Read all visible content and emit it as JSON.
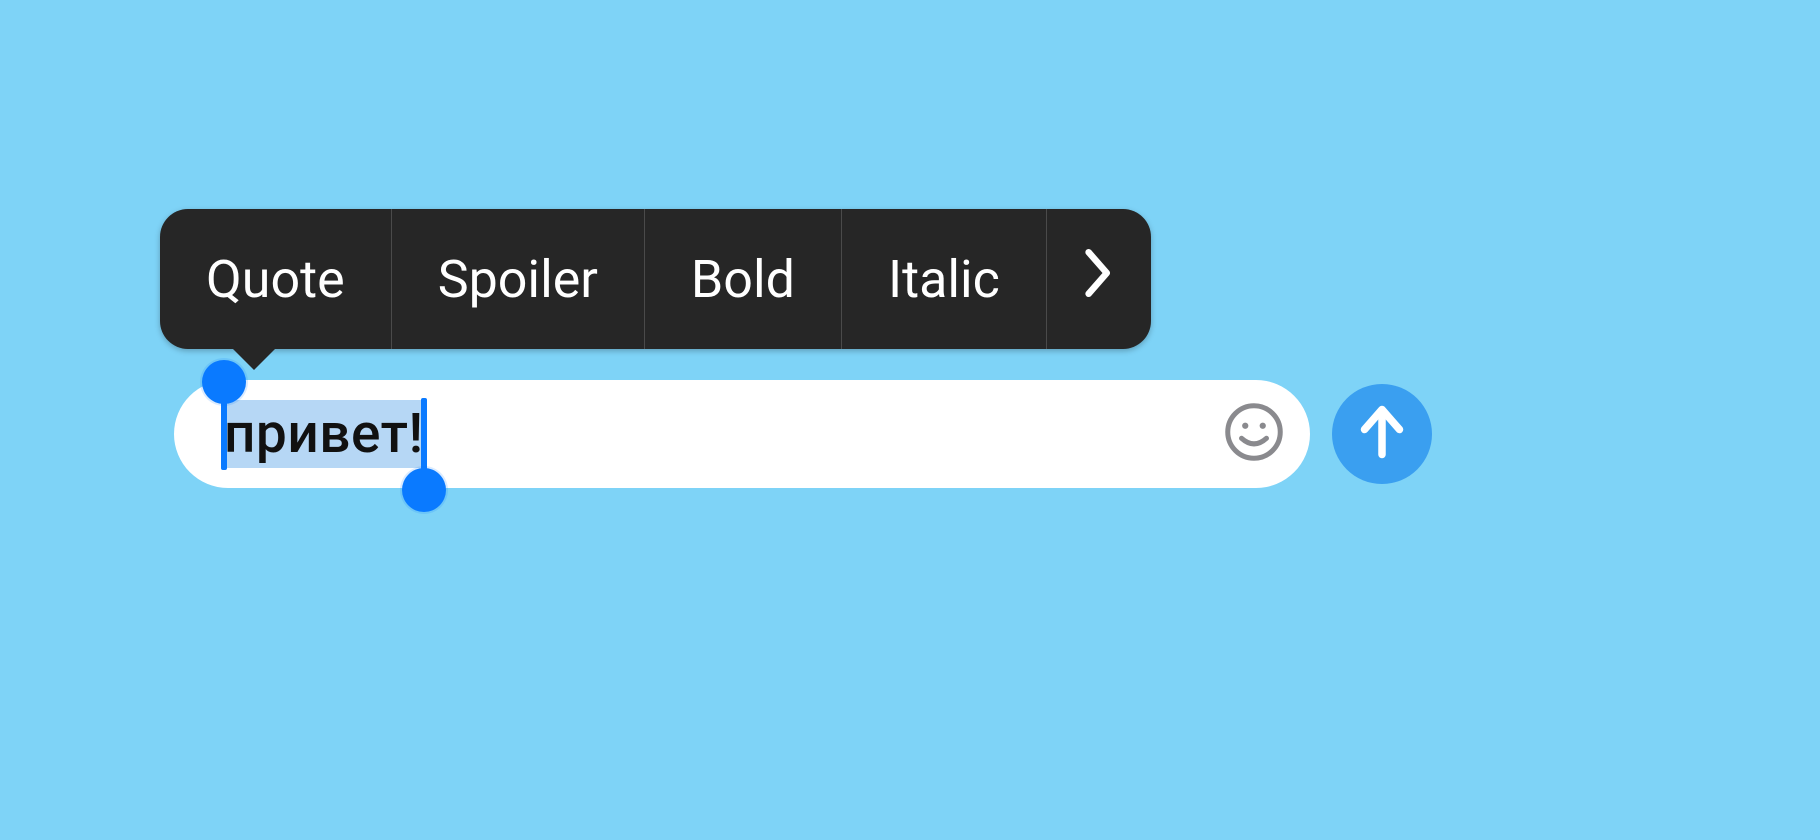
{
  "context_menu": {
    "items": [
      {
        "label": "Quote"
      },
      {
        "label": "Spoiler"
      },
      {
        "label": "Bold"
      },
      {
        "label": "Italic"
      }
    ],
    "more_icon": "chevron-right-icon"
  },
  "input": {
    "text": "привет!",
    "selection_all": true
  },
  "buttons": {
    "emoji_icon": "smile-icon",
    "send_icon": "arrow-up-icon"
  },
  "colors": {
    "background": "#7ed3f7",
    "menu_bg": "#262626",
    "accent": "#0a7aff",
    "send_bg": "#3a9ff0",
    "selection": "#b6d7f5"
  }
}
